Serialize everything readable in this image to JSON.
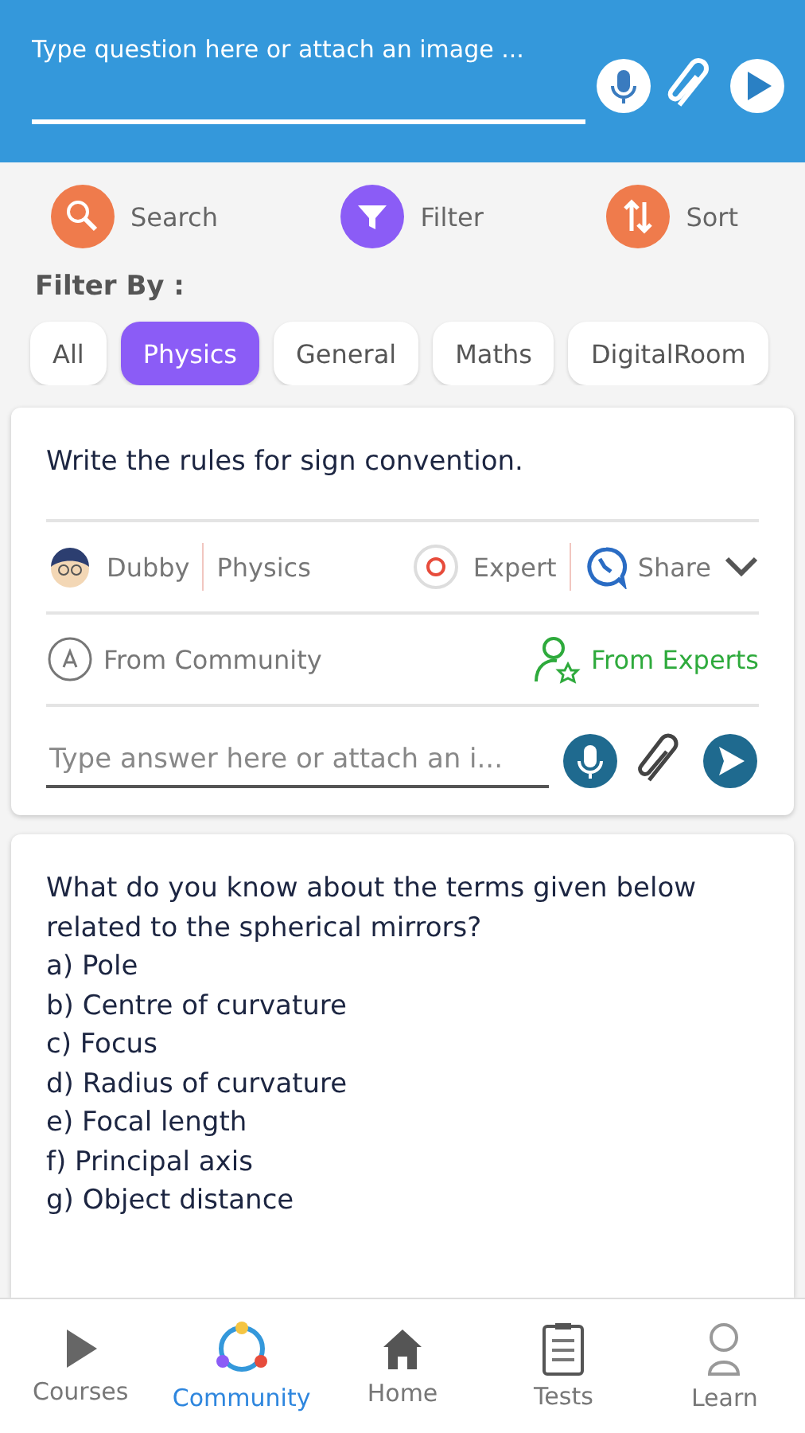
{
  "question_bar": {
    "placeholder": "Type question here or attach an image ..."
  },
  "actions": [
    {
      "kind": "search",
      "label": "Search"
    },
    {
      "kind": "filter",
      "label": "Filter"
    },
    {
      "kind": "sort",
      "label": "Sort"
    }
  ],
  "filter_by": {
    "label": "Filter By :",
    "chips": [
      {
        "label": "All",
        "selected": false
      },
      {
        "label": "Physics",
        "selected": true
      },
      {
        "label": "General",
        "selected": false
      },
      {
        "label": "Maths",
        "selected": false
      },
      {
        "label": "DigitalRoom",
        "selected": false
      }
    ]
  },
  "posts": [
    {
      "question": "Write the rules for sign convention.",
      "author": "Dubby",
      "subject": "Physics",
      "expert": "Expert",
      "share": "Share",
      "from_community": "From Community",
      "from_experts": "From Experts",
      "answer_placeholder": "Type answer here or attach an i..."
    }
  ],
  "next_post": {
    "lines": [
      "What do you know about the terms given below related to the spherical mirrors?",
      "a) Pole",
      "b) Centre of curvature",
      "c) Focus",
      "d) Radius of curvature",
      "e) Focal length",
      "f) Principal axis",
      "g) Object distance"
    ]
  },
  "bottom_nav": [
    {
      "kind": "courses",
      "label": "Courses",
      "selected": false
    },
    {
      "kind": "community",
      "label": "Community",
      "selected": true
    },
    {
      "kind": "home",
      "label": "Home",
      "selected": false
    },
    {
      "kind": "tests",
      "label": "Tests",
      "selected": false
    },
    {
      "kind": "learn",
      "label": "Learn",
      "selected": false
    }
  ]
}
